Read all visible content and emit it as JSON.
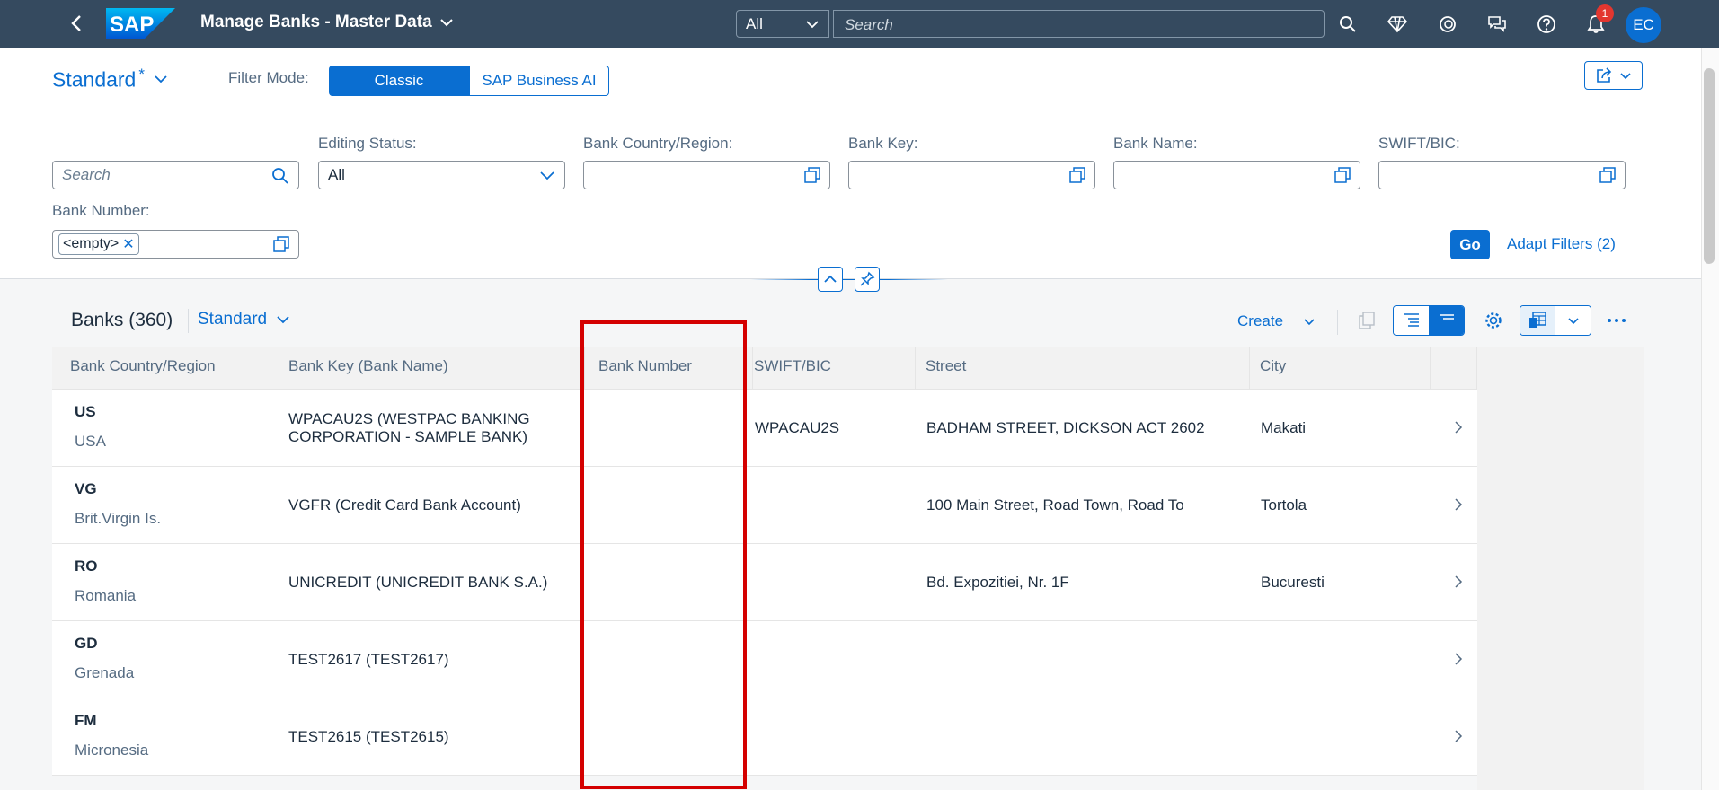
{
  "shell": {
    "logo_text": "SAP",
    "app_title": "Manage Banks - Master Data",
    "search_scope": "All",
    "search_placeholder": "Search",
    "notification_count": "1",
    "avatar_initials": "EC"
  },
  "header": {
    "variant_name": "Standard",
    "variant_modified": "*",
    "filter_mode_label": "Filter Mode:",
    "filter_modes": [
      "Classic",
      "SAP Business AI"
    ]
  },
  "filters": {
    "search_placeholder": "Search",
    "editing_status_label": "Editing Status:",
    "editing_status_value": "All",
    "bank_country_label": "Bank Country/Region:",
    "bank_key_label": "Bank Key:",
    "bank_name_label": "Bank Name:",
    "swift_label": "SWIFT/BIC:",
    "bank_number_label": "Bank Number:",
    "bank_number_token": "<empty>",
    "go_label": "Go",
    "adapt_filters_label": "Adapt Filters (2)"
  },
  "table": {
    "title": "Banks (360)",
    "variant": "Standard",
    "create_label": "Create",
    "columns": [
      "Bank Country/Region",
      "Bank Key (Bank Name)",
      "Bank Number",
      "SWIFT/BIC",
      "Street",
      "City"
    ],
    "rows": [
      {
        "code": "US",
        "country": "USA",
        "bank_key": "WPACAU2S (WESTPAC BANKING CORPORATION - SAMPLE BANK)",
        "bank_number": "",
        "swift": "WPACAU2S",
        "street": "BADHAM STREET, DICKSON ACT 2602",
        "city": "Makati"
      },
      {
        "code": "VG",
        "country": "Brit.Virgin Is.",
        "bank_key": "VGFR (Credit Card Bank Account)",
        "bank_number": "",
        "swift": "",
        "street": "100 Main Street, Road Town, Road To",
        "city": "Tortola"
      },
      {
        "code": "RO",
        "country": "Romania",
        "bank_key": "UNICREDIT (UNICREDIT BANK S.A.)",
        "bank_number": "",
        "swift": "",
        "street": "Bd. Expozitiei, Nr. 1F",
        "city": "Bucuresti"
      },
      {
        "code": "GD",
        "country": "Grenada",
        "bank_key": "TEST2617 (TEST2617)",
        "bank_number": "",
        "swift": "",
        "street": "",
        "city": ""
      },
      {
        "code": "FM",
        "country": "Micronesia",
        "bank_key": "TEST2615 (TEST2615)",
        "bank_number": "",
        "swift": "",
        "street": "",
        "city": ""
      }
    ]
  },
  "colors": {
    "shell_bg": "#354a5f",
    "accent": "#0a6ed1",
    "highlight": "#d40000",
    "notification_badge": "#e3362f"
  }
}
